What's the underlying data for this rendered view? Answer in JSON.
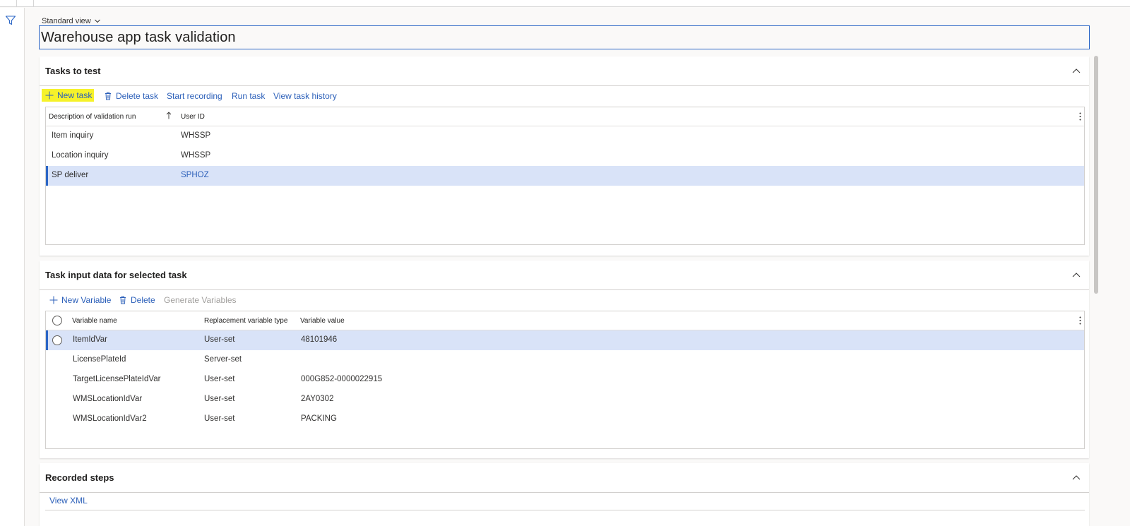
{
  "view_selector": "Standard view",
  "page_title": "Warehouse app task validation",
  "tasks_section": {
    "title": "Tasks to test",
    "toolbar": {
      "new_task": "New task",
      "delete_task": "Delete task",
      "start_recording": "Start recording",
      "run_task": "Run task",
      "view_task_history": "View task history"
    },
    "columns": [
      "Description of validation run",
      "User ID"
    ],
    "rows": [
      {
        "description": "Item inquiry",
        "user_id": "WHSSP",
        "selected": false
      },
      {
        "description": "Location inquiry",
        "user_id": "WHSSP",
        "selected": false
      },
      {
        "description": "SP deliver",
        "user_id": "SPHOZ",
        "selected": true
      }
    ]
  },
  "input_section": {
    "title": "Task input data for selected task",
    "toolbar": {
      "new_variable": "New Variable",
      "delete": "Delete",
      "generate_variables": "Generate Variables"
    },
    "columns": [
      "Variable name",
      "Replacement variable type",
      "Variable value"
    ],
    "rows": [
      {
        "name": "ItemIdVar",
        "type": "User-set",
        "value": "48101946",
        "selected": true
      },
      {
        "name": "LicensePlateId",
        "type": "Server-set",
        "value": "",
        "selected": false
      },
      {
        "name": "TargetLicensePlateIdVar",
        "type": "User-set",
        "value": "000G852-0000022915",
        "selected": false
      },
      {
        "name": "WMSLocationIdVar",
        "type": "User-set",
        "value": "2AY0302",
        "selected": false
      },
      {
        "name": "WMSLocationIdVar2",
        "type": "User-set",
        "value": "PACKING",
        "selected": false
      }
    ]
  },
  "recorded_section": {
    "title": "Recorded steps",
    "view_xml": "View XML"
  },
  "colors": {
    "accent": "#2b66c6",
    "link": "#2b5fb9",
    "selected_row": "#d9e3f8",
    "highlight": "#f6f22a"
  }
}
